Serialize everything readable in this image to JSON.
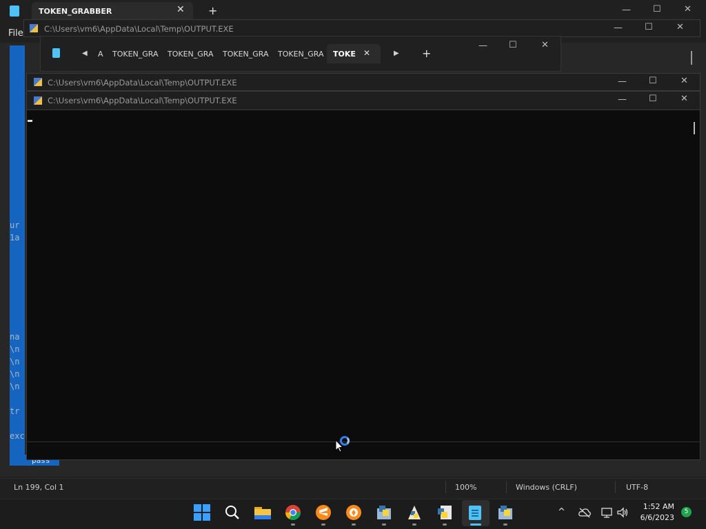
{
  "notepad": {
    "tab_title": "TOKEN_GRABBER",
    "menu_file": "File",
    "close_glyph": "✕",
    "new_tab_glyph": "+",
    "editor_fragments": [
      "ur",
      "1a",
      "na",
      "\\n",
      "\\n",
      "\\n",
      "\\n",
      "tr",
      "exc"
    ],
    "pass_text": "pass",
    "status": {
      "position": "Ln 199, Col 1",
      "zoom": "100%",
      "line_ending": "Windows (CRLF)",
      "encoding": "UTF-8"
    }
  },
  "console": {
    "title": "C:\\Users\\vm6\\AppData\\Local\\Temp\\OUTPUT.EXE"
  },
  "nested_notepad": {
    "tabs": [
      "A",
      "TOKEN_GRA",
      "TOKEN_GRA",
      "TOKEN_GRA",
      "TOKEN_GRA"
    ],
    "active_tab": "TOKE",
    "close_glyph": "✕",
    "new_tab_glyph": "+"
  },
  "window_controls": {
    "minimize": "—",
    "maximize": "☐",
    "close": "✕"
  },
  "taskbar": {
    "icons": [
      "windows-start-icon",
      "search-icon",
      "file-explorer-icon",
      "chrome-icon",
      "sublime-text-icon",
      "brave-icon",
      "python-installer-icon",
      "python-idle-icon",
      "python-console-icon",
      "notepad-icon",
      "python-setup-icon"
    ],
    "tray_chevron": "^",
    "clock_time": "1:52 AM",
    "clock_date": "6/6/2023",
    "notification_count": "5"
  }
}
